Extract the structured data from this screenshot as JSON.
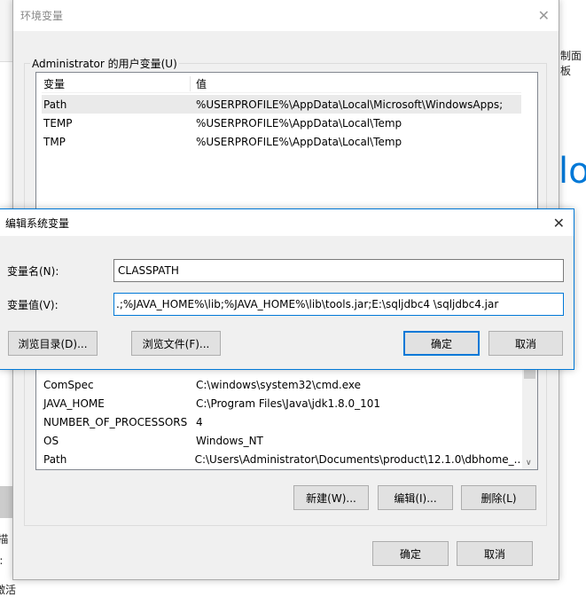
{
  "background": {
    "right_text": "制面板",
    "big_text": "lo",
    "left_texts": [
      "l描",
      "i:",
      "激活"
    ]
  },
  "env_dialog": {
    "title": "环境变量",
    "user_group_label": "Administrator 的用户变量(U)",
    "columns": [
      "变量",
      "值"
    ],
    "user_vars": [
      {
        "name": "Path",
        "value": "%USERPROFILE%\\AppData\\Local\\Microsoft\\WindowsApps;"
      },
      {
        "name": "TEMP",
        "value": "%USERPROFILE%\\AppData\\Local\\Temp"
      },
      {
        "name": "TMP",
        "value": "%USERPROFILE%\\AppData\\Local\\Temp"
      }
    ],
    "system_vars": [
      {
        "name": "ComSpec",
        "value": "C:\\windows\\system32\\cmd.exe"
      },
      {
        "name": "JAVA_HOME",
        "value": "C:\\Program Files\\Java\\jdk1.8.0_101"
      },
      {
        "name": "NUMBER_OF_PROCESSORS",
        "value": "4"
      },
      {
        "name": "OS",
        "value": "Windows_NT"
      },
      {
        "name": "Path",
        "value": "C:\\Users\\Administrator\\Documents\\product\\12.1.0\\dbhome_..."
      }
    ],
    "buttons": {
      "new": "新建(W)...",
      "edit": "编辑(I)...",
      "delete": "删除(L)",
      "ok": "确定",
      "cancel": "取消"
    }
  },
  "edit_dialog": {
    "title": "编辑系统变量",
    "name_label": "变量名(N):",
    "name_value": "CLASSPATH",
    "value_label": "变量值(V):",
    "value_value": ".;%JAVA_HOME%\\lib;%JAVA_HOME%\\lib\\tools.jar;E:\\sqljdbc4 \\sqljdbc4.jar",
    "buttons": {
      "browse_dir": "浏览目录(D)...",
      "browse_file": "浏览文件(F)...",
      "ok": "确定",
      "cancel": "取消"
    }
  },
  "colors": {
    "accent": "#0078d7"
  }
}
